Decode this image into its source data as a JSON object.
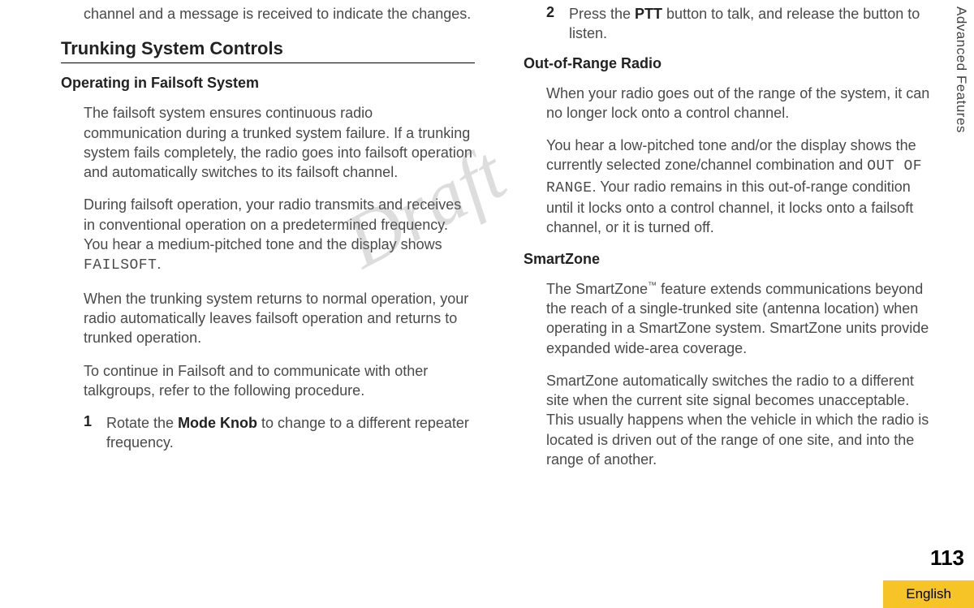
{
  "watermark": "Draft",
  "sideTab": "Advanced Features",
  "pageNum": "113",
  "lang": "English",
  "left": {
    "intro": "channel and a message is received to indicate the changes.",
    "heading": "Trunking System Controls",
    "sub1": "Operating in Failsoft System",
    "p1a": "The failsoft system ensures continuous radio communication during a trunked system failure. If a trunking system fails completely, the radio goes into failsoft operation and automatically switches to its failsoft channel.",
    "p1b_pre": "During failsoft operation, your radio transmits and receives in conventional operation on a predetermined frequency. You hear a medium-pitched tone and the display shows ",
    "p1b_code": "FAILSOFT",
    "p1b_post": ".",
    "p1c": "When the trunking system returns to normal operation, your radio automatically leaves failsoft operation and returns to trunked operation.",
    "p1d": "To continue in Failsoft and to communicate with other talkgroups, refer to the following procedure.",
    "step1_num": "1",
    "step1_pre": "Rotate the ",
    "step1_bold": "Mode Knob",
    "step1_post": " to change to a different repeater frequency."
  },
  "right": {
    "step2_num": "2",
    "step2_pre": "Press the ",
    "step2_bold": "PTT",
    "step2_post": " button to talk, and release the button to listen.",
    "sub2": "Out-of-Range Radio",
    "p2a": "When your radio goes out of the range of the system, it can no longer lock onto a control channel.",
    "p2b_pre": "You hear a low-pitched tone and/or the display shows the currently selected zone/channel combination and ",
    "p2b_code": "OUT OF RANGE",
    "p2b_post": ". Your radio remains in this out-of-range condition until it locks onto a control channel, it locks onto a failsoft channel, or it is turned off.",
    "sub3": "SmartZone",
    "p3a_pre": "The SmartZone",
    "p3a_tm": "™",
    "p3a_post": " feature extends communications beyond the reach of a single-trunked site (antenna location) when operating in a SmartZone system. SmartZone units provide expanded wide-area coverage.",
    "p3b": "SmartZone automatically switches the radio to a different site when the current site signal becomes unacceptable. This usually happens when the vehicle in which the radio is located is driven out of the range of one site, and into the range of another."
  }
}
